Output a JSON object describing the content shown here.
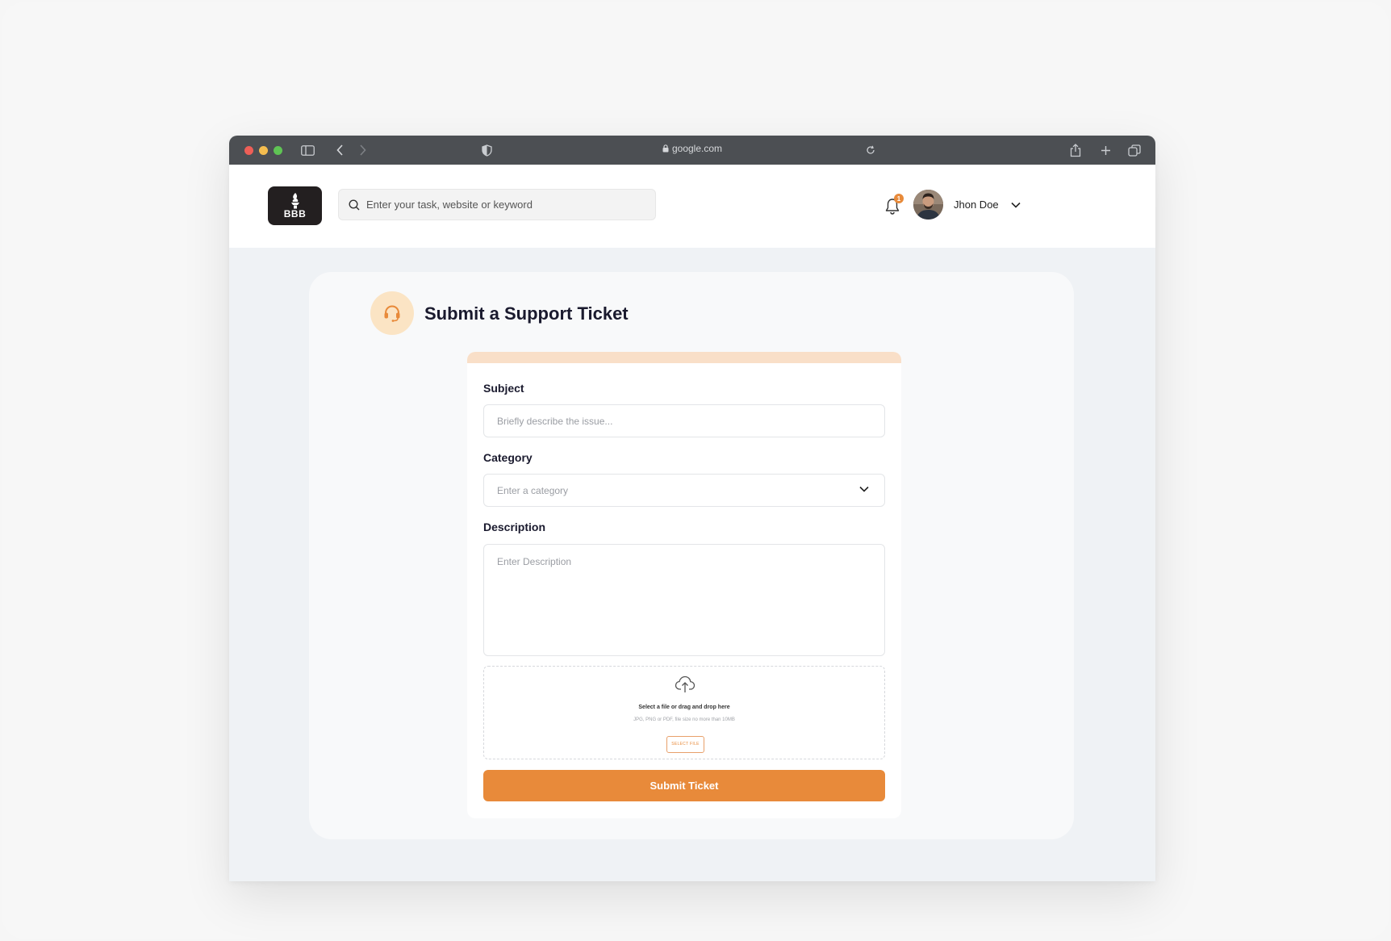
{
  "browser": {
    "url": "google.com"
  },
  "header": {
    "logo_text": "BBB",
    "search_placeholder": "Enter your task, website or keyword",
    "notification_count": "1",
    "user_name": "Jhon Doe"
  },
  "page": {
    "title": "Submit a Support Ticket"
  },
  "form": {
    "subject_label": "Subject",
    "subject_placeholder": "Briefly describe the issue...",
    "category_label": "Category",
    "category_placeholder": "Enter a category",
    "description_label": "Description",
    "description_placeholder": "Enter Description",
    "upload_title": "Select a file or drag and drop here",
    "upload_hint": "JPG, PNG or PDF, file size no more than 10MB",
    "upload_button": "SELECT FILE",
    "submit_label": "Submit Ticket"
  },
  "colors": {
    "accent": "#e88a3a",
    "accent_light": "#f9dfc8",
    "titlebar": "#4c4f53"
  }
}
